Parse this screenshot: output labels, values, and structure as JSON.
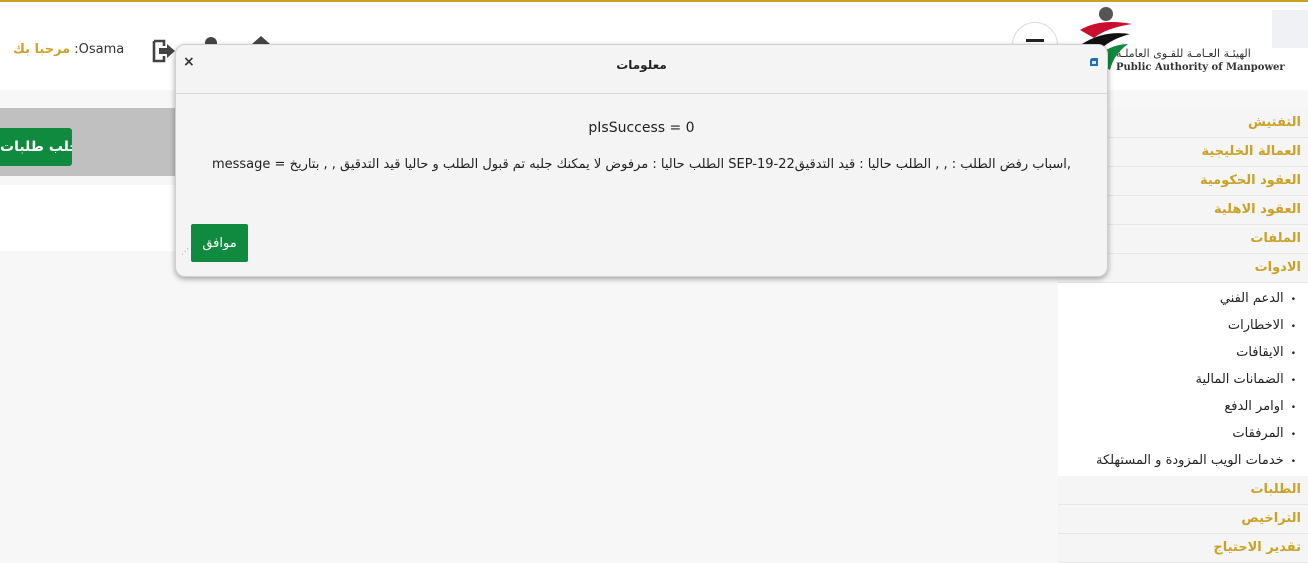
{
  "header": {
    "welcome_label": "مرحبا بك",
    "user_name": ":Osama",
    "logo_ar": "الهيئـة العـامـة للقـوى العاملـة",
    "logo_en": "Public Authority of Manpower",
    "icons": [
      "logout-icon",
      "user-icon",
      "home-icon",
      "menu-icon"
    ]
  },
  "main": {
    "fetch_button_label": "جلب طلبات"
  },
  "sidebar": {
    "items": [
      {
        "label": "التفتيش"
      },
      {
        "label": "العمالة الخليجية"
      },
      {
        "label": "العقود الحكومية"
      },
      {
        "label": "العقود الاهلية"
      },
      {
        "label": "الملفات"
      },
      {
        "label": "الادوات"
      }
    ],
    "subitems": [
      {
        "label": "الدعم الفني"
      },
      {
        "label": "الاخطارات"
      },
      {
        "label": "الايقافات"
      },
      {
        "label": "الضمانات المالية"
      },
      {
        "label": "اوامر الدفع"
      },
      {
        "label": "المرفقات"
      },
      {
        "label": "خدمات الويب المزودة و المستهلكة"
      }
    ],
    "items_after": [
      {
        "label": "الطلبات"
      },
      {
        "label": "التراخيص"
      },
      {
        "label": "تقدير الاحتياج"
      }
    ]
  },
  "modal": {
    "title": "معلومات",
    "close_symbol": "×",
    "success_line": "pIsSuccess = 0",
    "message_line": "message = الطلب حاليا : مرفوض لا يمكنك جلبه تم قبول الطلب و حاليا قيد التدقيق , , بتاريخ SEP-19-22اسباب رفض الطلب : , , الطلب حاليا : قيد التدقيق,",
    "ok_label": "موافق"
  },
  "colors": {
    "accent_gold": "#c9a227",
    "primary_green": "#0f8a3f",
    "gray_bar": "#c0c0c0"
  }
}
